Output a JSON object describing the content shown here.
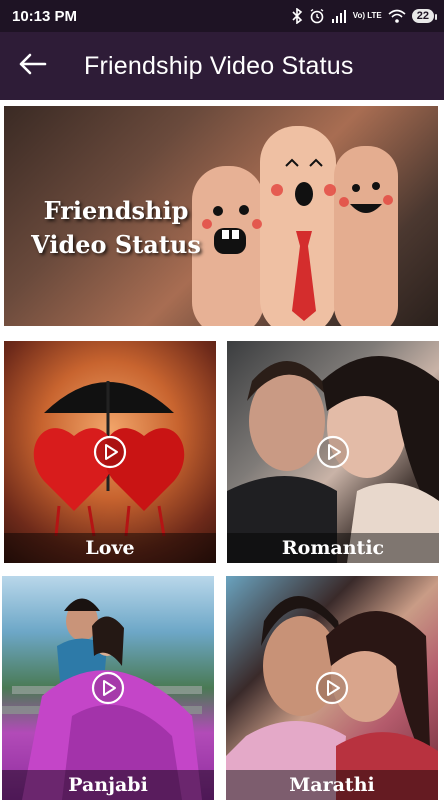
{
  "status_bar": {
    "time": "10:13 PM",
    "network_label": "Vo) LTE",
    "battery": "22",
    "icons": [
      "bluetooth-icon",
      "alarm-icon",
      "signal-icon",
      "lte-icon",
      "wifi-icon",
      "battery-icon"
    ]
  },
  "app_bar": {
    "title": "Friendship Video Status",
    "back_icon": "arrow-left-icon"
  },
  "banner": {
    "line1": "Friendship",
    "line2": "Video Status"
  },
  "categories": [
    {
      "label": "Love"
    },
    {
      "label": "Romantic"
    },
    {
      "label": "Panjabi"
    },
    {
      "label": "Marathi"
    }
  ],
  "colors": {
    "status_bar_bg": "#1e1324",
    "app_bar_bg": "#2e1c37",
    "text_on_dark": "#ffffff"
  }
}
